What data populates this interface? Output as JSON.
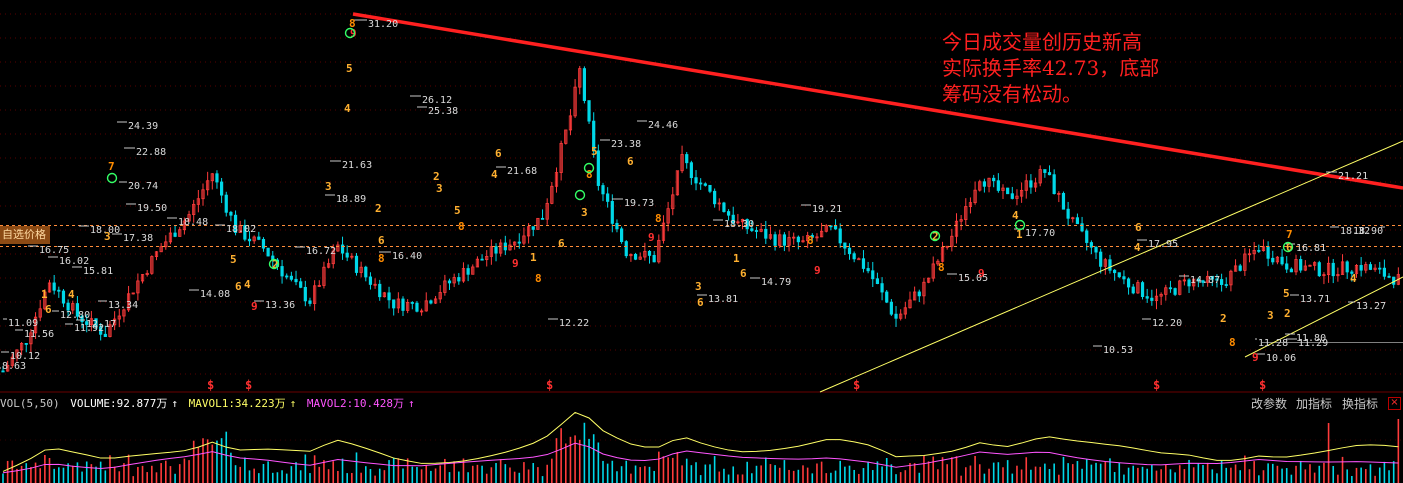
{
  "chart_data": {
    "type": "candlestick",
    "price_labels": [
      "31.20",
      "26.12",
      "25.38",
      "24.46",
      "24.39",
      "23.38",
      "22.88",
      "21.68",
      "21.63",
      "21.21",
      "20.74",
      "19.73",
      "19.50",
      "19.21",
      "18.89",
      "18.90",
      "18.48",
      "18.32",
      "18.30",
      "18.02",
      "18.00",
      "17.95",
      "17.70",
      "17.38",
      "16.81",
      "16.75",
      "16.72",
      "16.40",
      "16.02",
      "15.81",
      "15.05",
      "14.87",
      "14.79",
      "14.08",
      "13.81",
      "13.71",
      "13.36",
      "13.34",
      "13.27",
      "12.80",
      "12.22",
      "12.20",
      "12.17",
      "11.92",
      "11.80",
      "11.56",
      "11.29",
      "11.28",
      "11.09",
      "10.53",
      "10.12",
      "10.06",
      "8.63"
    ],
    "reference_lines": [
      "dashed upper level",
      "dashed lower level",
      "gray level"
    ],
    "trendline": {
      "color": "#ff2020",
      "from_label": "31.20",
      "to_label": "21.21"
    },
    "channel": {
      "color": "#ffff66"
    },
    "signal_digits": [
      "1",
      "2",
      "3",
      "4",
      "5",
      "6",
      "7",
      "8",
      "9"
    ],
    "markers": [
      "$",
      "$",
      "$",
      "$",
      "$",
      "$"
    ],
    "annotation_lines": [
      "今日成交量创历史新高",
      "实际换手率42.73，底部",
      "筹码没有松动。"
    ],
    "volume": {
      "indicator": "VOL(5,50)",
      "volume_label": "VOLUME:92.877万",
      "mavol1_label": "MAVOL1:34.223万",
      "mavol2_label": "MAVOL2:10.428万",
      "colors": {
        "up": "#ff3b3b",
        "down": "#00d8e8",
        "mavol1": "#ffff66",
        "mavol2": "#ff55ff"
      }
    },
    "colors": {
      "up": "#ff3b3b",
      "down": "#00d8e8",
      "dashed_line": "#ff8c3a",
      "label": "#dcdcdc"
    }
  },
  "toolbar": {
    "params_label": "改参数",
    "add_indicator_label": "加指标",
    "switch_indicator_label": "换指标"
  },
  "price_tag_label": "自选价格",
  "close_label": "×",
  "arrow_symbol": "↑"
}
